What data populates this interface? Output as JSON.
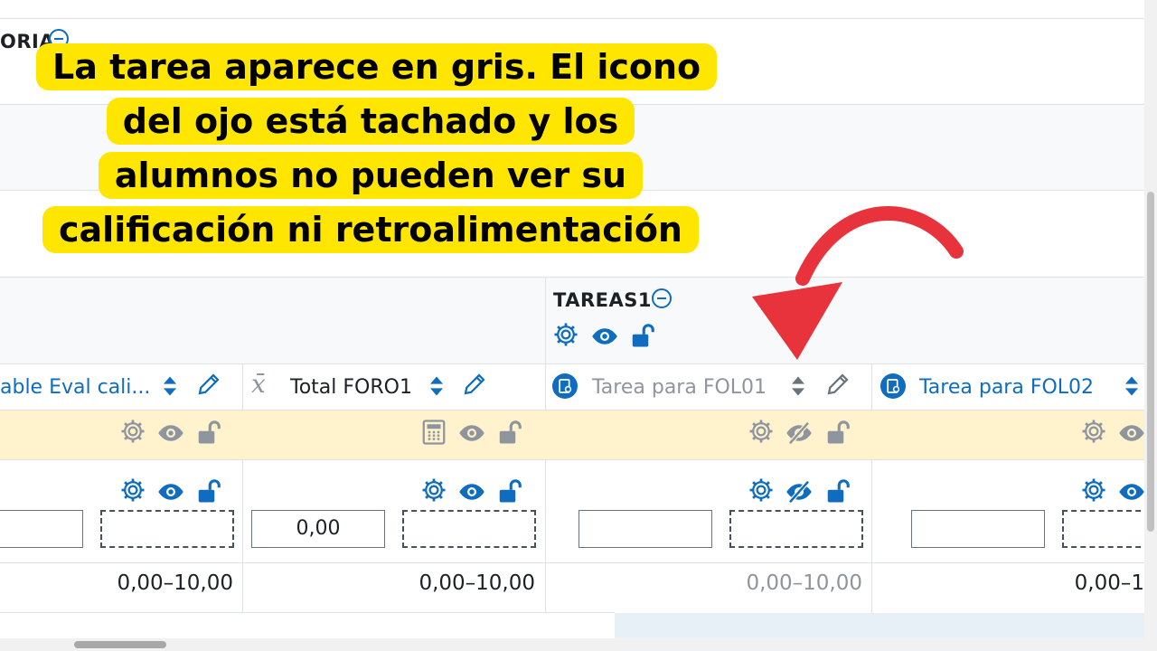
{
  "callout": {
    "text": "La tarea aparece en gris. El icono del ojo está tachado y los alumnos no pueden ver su calificación ni retroalimentación"
  },
  "categories": {
    "top_partial": "ORIA",
    "tareas": "TAREAS1"
  },
  "columns": [
    {
      "label": "able Eval cali...",
      "style": "link",
      "icon": "none"
    },
    {
      "label": "Total FORO1",
      "style": "normal",
      "icon": "x-bar-icon"
    },
    {
      "label": "Tarea para FOL01",
      "style": "grey",
      "icon": "assignment-icon"
    },
    {
      "label": "Tarea para FOL02",
      "style": "link",
      "icon": "assignment-icon"
    }
  ],
  "inputs": {
    "total_foro1_value": "0,00"
  },
  "ranges": [
    "0,00–10,00",
    "0,00–10,00",
    "0,00–10,00",
    "0,00–1"
  ],
  "colors": {
    "accent": "#0f6cbf",
    "highlight": "#ffe600",
    "arrow": "#e8323c",
    "row_highlight": "#fff3cd"
  }
}
